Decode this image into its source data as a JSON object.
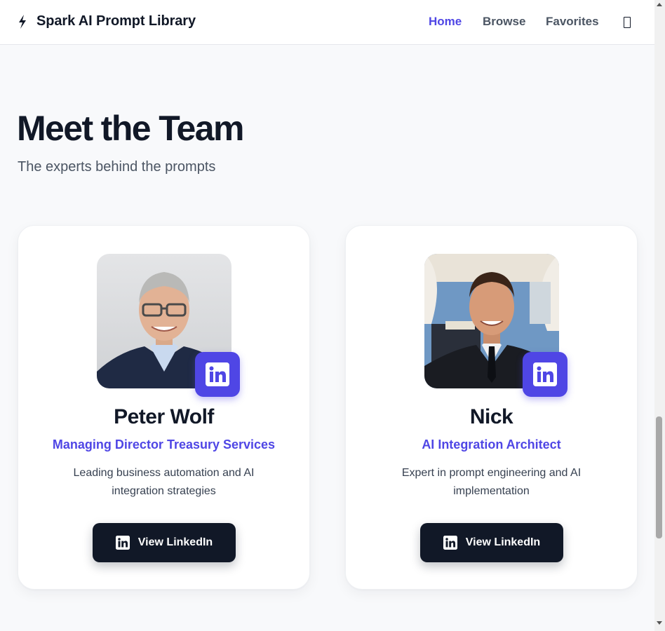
{
  "header": {
    "brand_name": "Spark AI Prompt Library",
    "nav": [
      {
        "label": "Home",
        "active": true
      },
      {
        "label": "Browse",
        "active": false
      },
      {
        "label": "Favorites",
        "active": false
      }
    ],
    "bolt_icon": "lightning-bolt-icon",
    "theme_toggle_icon": "theme-toggle-icon"
  },
  "section": {
    "title": "Meet the Team",
    "subtitle": "The experts behind the prompts"
  },
  "team": [
    {
      "name": "Peter Wolf",
      "role": "Managing Director Treasury Services",
      "bio": "Leading business automation and AI integration strategies",
      "button_label": "View LinkedIn"
    },
    {
      "name": "Nick",
      "role": "AI Integration Architect",
      "bio": "Expert in prompt engineering and AI implementation",
      "button_label": "View LinkedIn"
    }
  ],
  "colors": {
    "accent": "#4f46e5",
    "dark": "#111827",
    "muted": "#4b5563",
    "background": "#f8f9fb"
  }
}
